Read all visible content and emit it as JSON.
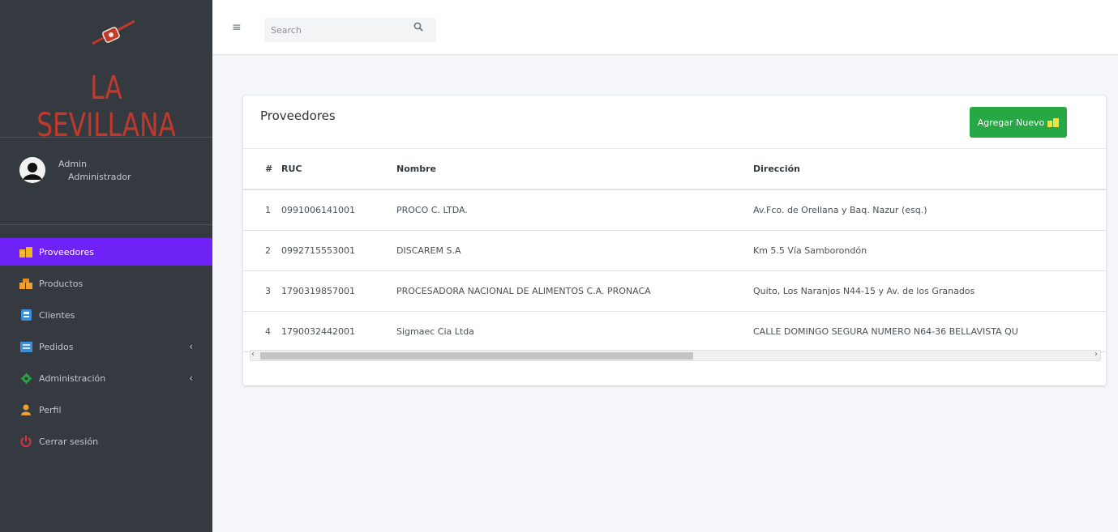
{
  "brand": {
    "name": "LA SEVILLANA",
    "subtitle": "· · · · · · · · ·"
  },
  "user": {
    "name": "Admin",
    "role": "Administrador"
  },
  "sidebar": {
    "items": [
      {
        "label": "Proveedores",
        "icon": "suppliers-icon",
        "color": "#f0b429",
        "active": true
      },
      {
        "label": "Productos",
        "icon": "boxes-icon",
        "color": "#f0a030"
      },
      {
        "label": "Clientes",
        "icon": "id-card-icon",
        "color": "#3a8fd8"
      },
      {
        "label": "Pedidos",
        "icon": "list-icon",
        "color": "#3a8fd8",
        "arrow": "‹"
      },
      {
        "label": "Administración",
        "icon": "gear-icon",
        "color": "#28a745",
        "arrow": "‹"
      },
      {
        "label": "Perfil",
        "icon": "user-icon",
        "color": "#f0a030"
      },
      {
        "label": "Cerrar sesión",
        "icon": "power-icon",
        "color": "#dc3545"
      }
    ]
  },
  "topbar": {
    "menu_glyph": "≡",
    "search_placeholder": "Search",
    "search_glyph": "🔍"
  },
  "card": {
    "title": "Proveedores",
    "add_label": "Agregar Nuevo"
  },
  "table": {
    "headers": [
      "#",
      "RUC",
      "Nombre",
      "Dirección"
    ],
    "rows": [
      [
        "1",
        "0991006141001",
        "PROCO C. LTDA.",
        "Av.Fco. de Orellana y Baq. Nazur (esq.)"
      ],
      [
        "2",
        "0992715553001",
        "DISCAREM S.A",
        "Km 5.5 Vía Samborondón"
      ],
      [
        "3",
        "1790319857001",
        "PROCESADORA NACIONAL DE ALIMENTOS C.A. PRONACA",
        "Quito, Los Naranjos N44-15 y Av. de los Granados"
      ],
      [
        "4",
        "1790032442001",
        "Sigmaec Cia Ltda",
        "CALLE DOMINGO SEGURA NUMERO N64-36 BELLAVISTA QU"
      ]
    ]
  },
  "colors": {
    "sidebar_bg": "#343a40",
    "active_item": "#6f22f5",
    "add_button": "#28a745",
    "brand_red": "#c0392b"
  }
}
